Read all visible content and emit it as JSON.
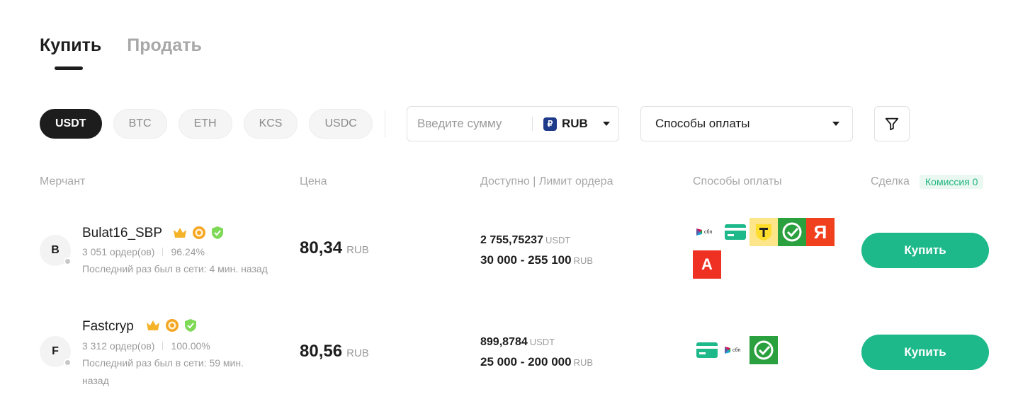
{
  "tabs": [
    {
      "label": "Купить",
      "active": true
    },
    {
      "label": "Продать",
      "active": false
    }
  ],
  "coins": [
    "USDT",
    "BTC",
    "ETH",
    "KCS",
    "USDC"
  ],
  "selected_coin": "USDT",
  "amount": {
    "placeholder": "Введите сумму",
    "currency": "RUB",
    "currency_symbol": "₽"
  },
  "payment_filter": {
    "label": "Способы оплаты"
  },
  "filter_button": {
    "icon": "funnel-icon"
  },
  "table": {
    "headers": {
      "merchant": "Мерчант",
      "price": "Цена",
      "available": "Доступно | Лимит ордера",
      "payment": "Способы оплаты",
      "deal": "Сделка"
    },
    "fee_badge": "Комиссия 0"
  },
  "offers": [
    {
      "avatar_letter": "B",
      "name": "Bulat16_SBP",
      "badges": [
        "crown-icon",
        "medal-icon",
        "shield-check-icon"
      ],
      "orders": "3 051 ордер(ов)",
      "completion": "96.24%",
      "last_seen": "Последний раз был в сети: 4 мин. назад",
      "price": "80,34",
      "price_unit": "RUB",
      "available": "2 755,75237",
      "available_unit": "USDT",
      "limit": "30 000 - 255 100",
      "limit_unit": "RUB",
      "payment_methods": [
        "sbp-icon",
        "card-icon",
        "tbank-icon",
        "sber-icon",
        "yandex-icon",
        "alfa-icon"
      ],
      "yandex_letter": "Я",
      "alfa_letter": "А",
      "buy_label": "Купить"
    },
    {
      "avatar_letter": "F",
      "name": "Fastcryp",
      "badges": [
        "crown-icon",
        "medal-icon",
        "shield-check-icon"
      ],
      "orders": "3 312 ордер(ов)",
      "completion": "100.00%",
      "last_seen": "Последний раз был в сети: 59 мин. назад",
      "price": "80,56",
      "price_unit": "RUB",
      "available": "899,8784",
      "available_unit": "USDT",
      "limit": "25 000 - 200 000",
      "limit_unit": "RUB",
      "payment_methods": [
        "card-icon",
        "sbp-icon",
        "sber-icon"
      ],
      "buy_label": "Купить"
    }
  ],
  "colors": {
    "accent": "#1db98a",
    "dark": "#1d1d1d",
    "muted": "#a8a8a8",
    "fee_text": "#1fb57f"
  }
}
